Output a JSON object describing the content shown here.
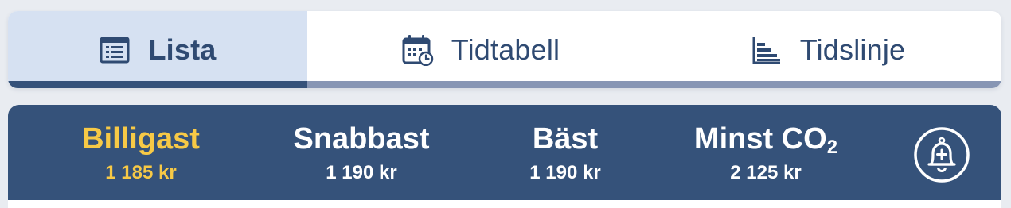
{
  "view_tabs": [
    {
      "label": "Lista",
      "icon": "list-icon",
      "selected": true
    },
    {
      "label": "Tidtabell",
      "icon": "calendar-clock-icon",
      "selected": false
    },
    {
      "label": "Tidslinje",
      "icon": "timeline-chart-icon",
      "selected": false
    }
  ],
  "sort_options": {
    "cheapest": {
      "label": "Billigast",
      "price": "1 185 kr",
      "selected": true
    },
    "fastest": {
      "label": "Snabbast",
      "price": "1 190 kr",
      "selected": false
    },
    "best": {
      "label": "Bäst",
      "price": "1 190 kr",
      "selected": false
    },
    "co2": {
      "label": "Minst CO",
      "label_subscript": "2",
      "price": "2 125 kr",
      "selected": false
    }
  },
  "alert_button": {
    "icon": "bell-plus-icon"
  },
  "colors": {
    "primary": "#35527a",
    "tab_selected_bg": "#d6e1f2",
    "tab_text": "#2f4a72",
    "active_sort": "#f7c946",
    "tab_underline_inactive": "#8796b4"
  }
}
